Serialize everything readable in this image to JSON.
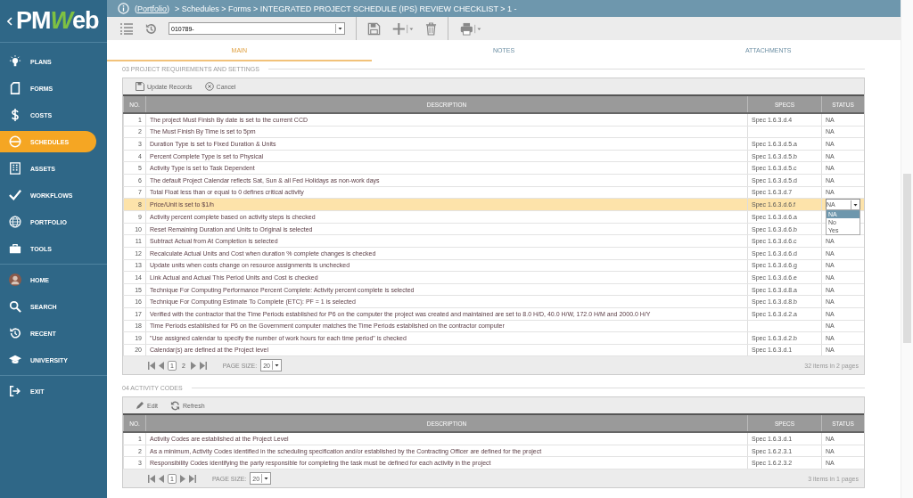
{
  "logo": {
    "prefix": "PM",
    "accent": "W",
    "suffix": "eb"
  },
  "sidebar": {
    "items": [
      {
        "label": "PLANS",
        "selected": false
      },
      {
        "label": "FORMS",
        "selected": false
      },
      {
        "label": "COSTS",
        "selected": false
      },
      {
        "label": "SCHEDULES",
        "selected": true
      },
      {
        "label": "ASSETS",
        "selected": false
      },
      {
        "label": "WORKFLOWS",
        "selected": false
      },
      {
        "label": "PORTFOLIO",
        "selected": false
      },
      {
        "label": "TOOLS",
        "selected": false
      }
    ],
    "user_items": [
      {
        "label": "HOME"
      },
      {
        "label": "SEARCH"
      },
      {
        "label": "RECENT"
      },
      {
        "label": "UNIVERSITY"
      }
    ],
    "exit": {
      "label": "EXIT"
    }
  },
  "breadcrumb": {
    "link": "(Portfolio)",
    "rest": "> Schedules > Forms > INTEGRATED PROJECT SCHEDULE (IPS) REVIEW CHECKLIST > 1 -"
  },
  "toolbar": {
    "record": "010789-"
  },
  "tabs": [
    {
      "label": "MAIN",
      "selected": true
    },
    {
      "label": "NOTES",
      "selected": false
    },
    {
      "label": "ATTACHMENTS",
      "selected": false
    }
  ],
  "sections": [
    {
      "title": "03 PROJECT REQUIREMENTS AND SETTINGS",
      "actions": [
        {
          "kind": "save",
          "label": "Update Records"
        },
        {
          "kind": "cancel",
          "label": "Cancel"
        }
      ],
      "columns": [
        "NO.",
        "DESCRIPTION",
        "SPECS",
        "STATUS"
      ],
      "rows": [
        {
          "no": "1",
          "description": "The project Must Finish By date is set to the current CCD",
          "specs": "Spec 1.6.3.d.4",
          "status": "NA",
          "selected": false
        },
        {
          "no": "2",
          "description": "The Must Finish By Time is set to 5pm",
          "status": "NA",
          "selected": false
        },
        {
          "no": "3",
          "description": "Duration Type is set to Fixed Duration & Units",
          "specs": "Spec 1.6.3.d.5.a",
          "status": "NA",
          "selected": false
        },
        {
          "no": "4",
          "description": "Percent Complete Type is set to Physical",
          "specs": "Spec 1.6.3.d.5.b",
          "status": "NA",
          "selected": false
        },
        {
          "no": "5",
          "description": "Activity Type is set to Task Dependent",
          "specs": "Spec 1.6.3.d.5.c",
          "status": "NA",
          "selected": false
        },
        {
          "no": "6",
          "description": "The default Project Calendar reflects Sat, Sun & all Fed Holidays as non-work days",
          "specs": "Spec 1.6.3.d.5.d",
          "status": "NA",
          "selected": false
        },
        {
          "no": "7",
          "description": "Total Float less than or equal to 0 defines critical activity",
          "specs": "Spec 1.6.3.d.7",
          "status": "NA",
          "selected": false
        },
        {
          "no": "8",
          "description": "Price/Unit is set to $1/h",
          "specs": "Spec 1.6.3.d.6.f",
          "status": "NA",
          "selected": true,
          "status_options": [
            {
              "label": "NA",
              "selected": true
            },
            {
              "label": "No",
              "selected": false
            },
            {
              "label": "Yes",
              "selected": false
            }
          ]
        },
        {
          "no": "9",
          "description": "Activity percent complete based on activity steps is checked",
          "specs": "Spec 1.6.3.d.6.a",
          "selected": false
        },
        {
          "no": "10",
          "description": "Reset Remaining Duration and Units to Original is selected",
          "specs": "Spec 1.6.3.d.6.b",
          "selected": false
        },
        {
          "no": "11",
          "description": "Subtract Actual from At Completion is selected",
          "specs": "Spec 1.6.3.d.6.c",
          "status": "NA",
          "selected": false
        },
        {
          "no": "12",
          "description": "Recalculate Actual Units and Cost when duration % complete changes is checked",
          "specs": "Spec 1.6.3.d.6.d",
          "status": "NA",
          "selected": false
        },
        {
          "no": "13",
          "description": "Update units when costs change on resource assignments is unchecked",
          "specs": "Spec 1.6.3.d.6.g",
          "status": "NA",
          "selected": false
        },
        {
          "no": "14",
          "description": "Link Actual and Actual This Period Units and Cost is checked",
          "specs": "Spec 1.6.3.d.6.e",
          "status": "NA",
          "selected": false
        },
        {
          "no": "15",
          "description": "Technique For Computing Performance Percent Complete: Activity percent complete is selected",
          "specs": "Spec 1.6.3.d.8.a",
          "status": "NA",
          "selected": false
        },
        {
          "no": "16",
          "description": "Technique For Computing Estimate To Complete (ETC): PF = 1 is selected",
          "specs": "Spec 1.6.3.d.8.b",
          "status": "NA",
          "selected": false
        },
        {
          "no": "17",
          "description": "Verified with the contractor that the Time Periods established for P6 on the computer the project was created and maintained are set to 8.0 H/D, 40.0 H/W, 172.0 H/M and 2000.0 H/Y",
          "specs": "Spec 1.6.3.d.2.a",
          "status": "NA",
          "selected": false
        },
        {
          "no": "18",
          "description": "Time Periods established for P6 on the Government computer matches the Time Periods established on the contractor computer",
          "status": "NA",
          "selected": false
        },
        {
          "no": "19",
          "description": "\"Use assigned calendar to specify the number of work hours for each time period\" is checked",
          "specs": "Spec 1.6.3.d.2.b",
          "status": "NA",
          "selected": false
        },
        {
          "no": "20",
          "description": "Calendar(s) are defined at the Project level",
          "specs": "Spec 1.6.3.d.1",
          "status": "NA",
          "selected": false
        }
      ],
      "pager": {
        "pages": [
          {
            "label": "1",
            "selected": true
          },
          {
            "label": "2",
            "selected": false
          }
        ],
        "page_size_label": "PAGE SIZE:",
        "page_size": "20",
        "summary": "32 items in 2 pages"
      }
    },
    {
      "title": "04 ACTIVITY CODES",
      "actions": [
        {
          "kind": "edit",
          "label": "Edit"
        },
        {
          "kind": "refresh",
          "label": "Refresh"
        }
      ],
      "columns": [
        "NO.",
        "DESCRIPTION",
        "SPECS",
        "STATUS"
      ],
      "rows": [
        {
          "no": "1",
          "description": "Activity Codes are established at the Project Level",
          "specs": "Spec 1.6.3.d.1",
          "status": "NA",
          "selected": false
        },
        {
          "no": "2",
          "description": "As a minimum, Activity Codes identified in the scheduling specification and/or established by the Contracting Officer are defined for the project",
          "specs": "Spec 1.6.2.3.1",
          "status": "NA",
          "selected": false
        },
        {
          "no": "3",
          "description": "Responsibility Codes identifying the party responsible for completing the task must be defined for each activity in the project",
          "specs": "Spec 1.6.2.3.2",
          "status": "NA",
          "selected": false
        }
      ],
      "pager": {
        "pages": [
          {
            "label": "1",
            "selected": true
          }
        ],
        "page_size_label": "PAGE SIZE:",
        "page_size": "20",
        "summary": "3 items in 1 pages"
      }
    }
  ]
}
